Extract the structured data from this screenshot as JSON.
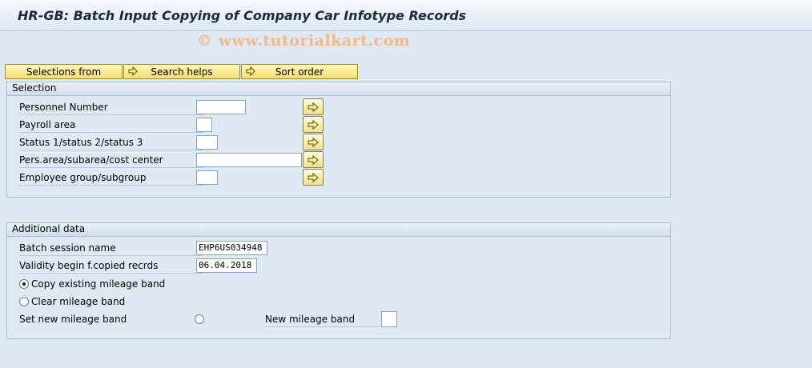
{
  "window": {
    "title": "HR-GB: Batch Input Copying of Company Car Infotype Records",
    "watermark": "© www.tutorialkart.com"
  },
  "toolbar": {
    "selections_from": "Selections from",
    "search_helps": "Search helps",
    "sort_order": "Sort order"
  },
  "selection": {
    "heading": "Selection",
    "fields": [
      {
        "label": "Personnel Number",
        "value": ""
      },
      {
        "label": "Payroll area",
        "value": ""
      },
      {
        "label": "Status 1/status 2/status 3",
        "value": ""
      },
      {
        "label": "Pers.area/subarea/cost center",
        "value": ""
      },
      {
        "label": "Employee group/subgroup",
        "value": ""
      }
    ]
  },
  "additional": {
    "heading": "Additional data",
    "batch_session_label": "Batch session name",
    "batch_session_value": "EHP6US034948",
    "validity_label": "Validity begin f.copied recrds",
    "validity_value": "06.04.2018",
    "radio_copy": "Copy existing mileage band",
    "radio_clear": "Clear mileage band",
    "radio_set": "Set new mileage band",
    "new_band_label": "New mileage band",
    "new_band_value": ""
  }
}
